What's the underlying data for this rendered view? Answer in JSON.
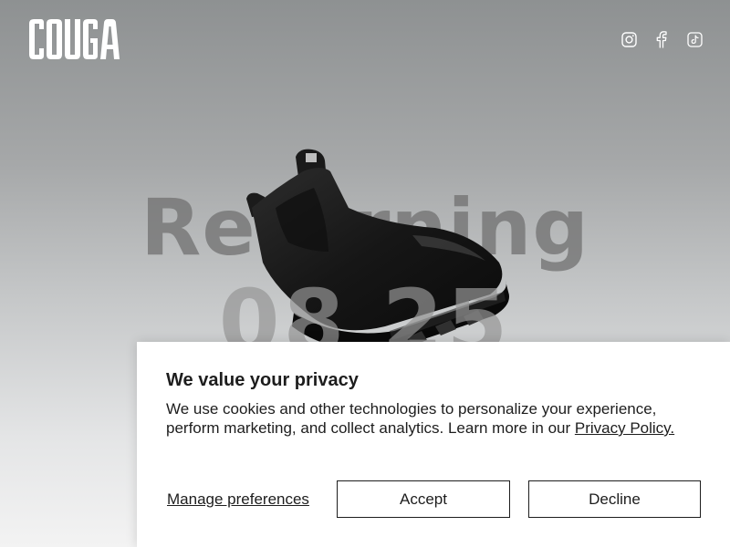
{
  "brand": {
    "logo_text": "COUGAR"
  },
  "header": {
    "social_links": [
      {
        "icon": "instagram-icon"
      },
      {
        "icon": "facebook-icon"
      },
      {
        "icon": "tiktok-icon"
      }
    ]
  },
  "hero": {
    "title": "Returning",
    "date": "08 25"
  },
  "cookie_banner": {
    "title": "We value your privacy",
    "body": "We use cookies and other technologies to personalize your experience, perform marketing, and collect analytics. Learn more in our ",
    "privacy_link": "Privacy Policy.",
    "manage_label": "Manage preferences",
    "accept_label": "Accept",
    "decline_label": "Decline"
  },
  "colors": {
    "text": "#1d1d1d",
    "banner_bg": "#ffffff",
    "logo": "#ffffff"
  }
}
